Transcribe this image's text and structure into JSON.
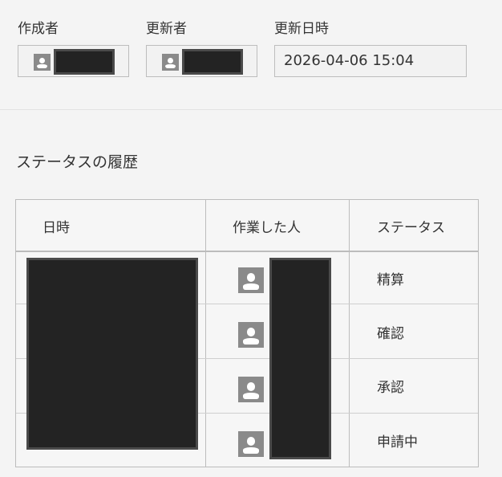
{
  "meta": {
    "created_by": {
      "label": "作成者"
    },
    "updated_by": {
      "label": "更新者"
    },
    "updated_at": {
      "label": "更新日時",
      "value": "2026-04-06 15:04"
    }
  },
  "history": {
    "title": "ステータスの履歴",
    "columns": [
      "日時",
      "作業した人",
      "ステータス"
    ],
    "rows": [
      {
        "status": "精算"
      },
      {
        "status": "確認"
      },
      {
        "status": "承認"
      },
      {
        "status": "申請中"
      }
    ]
  },
  "icons": {
    "avatar": "user-silhouette-icon"
  },
  "colors": {
    "avatar_bg": "#8a8a8a",
    "redaction": "#232323"
  }
}
